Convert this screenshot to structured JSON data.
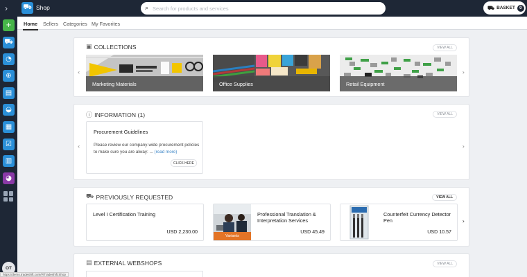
{
  "app": {
    "title": "Shop",
    "search_placeholder": "Search for products and services",
    "basket_label": "BASKET",
    "basket_count": "0",
    "user_initials": "OT",
    "status_url": "https://demo.tradeshift.com/#/Tradeshift.Shop",
    "accent_color": "#2a8fd8",
    "rail_color": "#1e2736"
  },
  "rail": {
    "items": [
      {
        "icon": "plus-icon",
        "glyph": "+",
        "color": "green"
      },
      {
        "icon": "cart-icon",
        "glyph": "🛒",
        "color": "blue"
      },
      {
        "icon": "pie-chart-icon",
        "glyph": "◔",
        "color": "blue"
      },
      {
        "icon": "globe-icon",
        "glyph": "⊕",
        "color": "blue"
      },
      {
        "icon": "document-search-icon",
        "glyph": "▤",
        "color": "blue"
      },
      {
        "icon": "dashboard-icon",
        "glyph": "◒",
        "color": "blue"
      },
      {
        "icon": "storefront-icon",
        "glyph": "▦",
        "color": "blue"
      },
      {
        "icon": "checklist-icon",
        "glyph": "☑",
        "color": "blue"
      },
      {
        "icon": "clipboard-icon",
        "glyph": "▥",
        "color": "blue"
      },
      {
        "icon": "pie-purple-icon",
        "glyph": "◕",
        "color": "purple"
      }
    ]
  },
  "tabs": [
    "Home",
    "Sellers",
    "Categories",
    "My Favorites"
  ],
  "collections": {
    "heading": "COLLECTIONS",
    "view_all": "VIEW ALL",
    "items": [
      "Marketing Materials",
      "Office Supplies",
      "Retail Equipment"
    ]
  },
  "information": {
    "heading": "INFORMATION (1)",
    "view_all": "VIEW ALL",
    "card_title": "Procurement Guidelines",
    "card_body": "Please review our company-wide procurement policies to make sure you are alway: ...",
    "read_more": "(read more)",
    "button": "CLICK HERE"
  },
  "previously_requested": {
    "heading": "PREVIOUSLY REQUESTED",
    "view_all": "VIEW ALL",
    "items": [
      {
        "name": "Level I Certification Training",
        "price": "USD 2,230.00"
      },
      {
        "name": "Professional Translation & Interpretation Services",
        "price": "USD 45.49",
        "badge": "Variants"
      },
      {
        "name": "Counterfeit Currency Detector Pen",
        "price": "USD 10.57"
      }
    ]
  },
  "external_webshops": {
    "heading": "EXTERNAL WEBSHOPS",
    "view_all": "VIEW ALL"
  }
}
